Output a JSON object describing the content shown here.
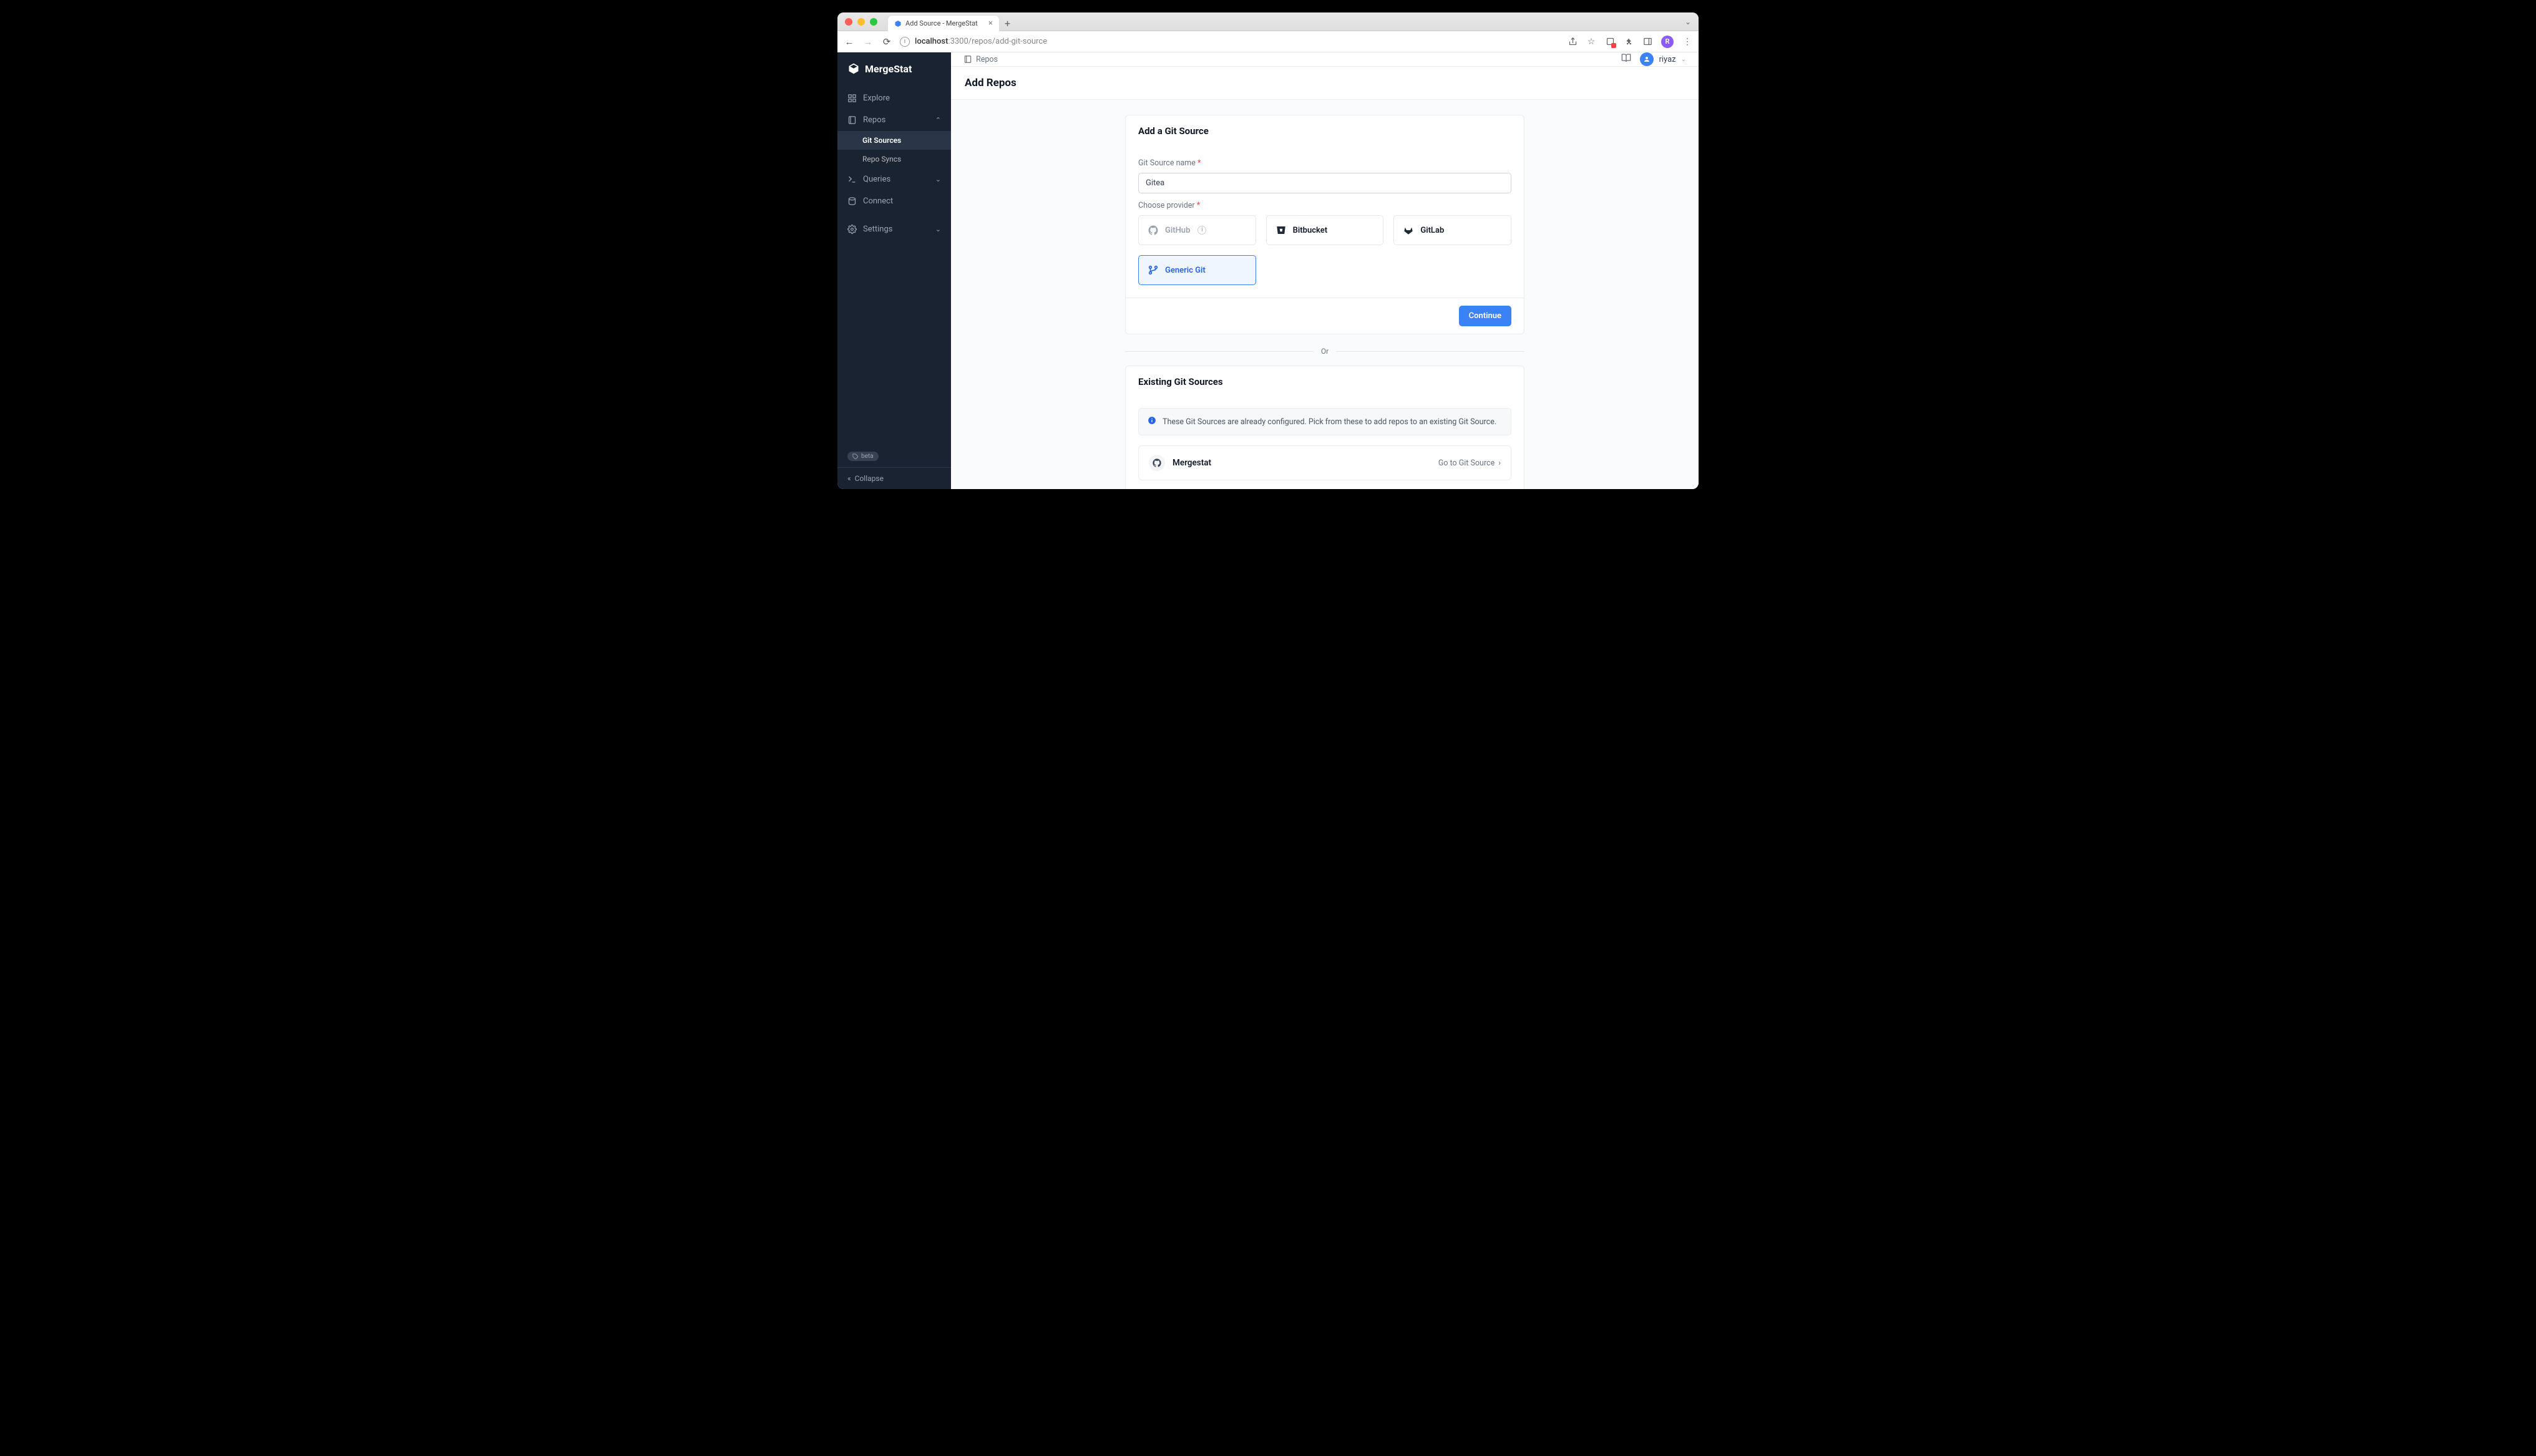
{
  "browser": {
    "tab_title": "Add Source - MergeStat",
    "url_host": "localhost",
    "url_port_path": ":3300/repos/add-git-source",
    "profile_initial": "R"
  },
  "sidebar": {
    "brand": "MergeStat",
    "items": [
      {
        "label": "Explore"
      },
      {
        "label": "Repos"
      },
      {
        "label": "Queries"
      },
      {
        "label": "Connect"
      },
      {
        "label": "Settings"
      }
    ],
    "repos_sub": [
      {
        "label": "Git Sources"
      },
      {
        "label": "Repo Syncs"
      }
    ],
    "beta": "beta",
    "collapse": "Collapse"
  },
  "topbar": {
    "crumb": "Repos",
    "user": "riyaz"
  },
  "page": {
    "title": "Add Repos"
  },
  "form": {
    "card_title": "Add a Git Source",
    "name_label": "Git Source name",
    "name_value": "Gitea",
    "provider_label": "Choose provider",
    "providers": {
      "github": "GitHub",
      "bitbucket": "Bitbucket",
      "gitlab": "GitLab",
      "generic": "Generic Git"
    },
    "continue": "Continue"
  },
  "or": "Or",
  "existing": {
    "title": "Existing Git Sources",
    "notice": "These Git Sources are already configured. Pick from these to add repos to an existing Git Source.",
    "rows": [
      {
        "name": "Mergestat",
        "action": "Go to Git Source"
      }
    ]
  }
}
